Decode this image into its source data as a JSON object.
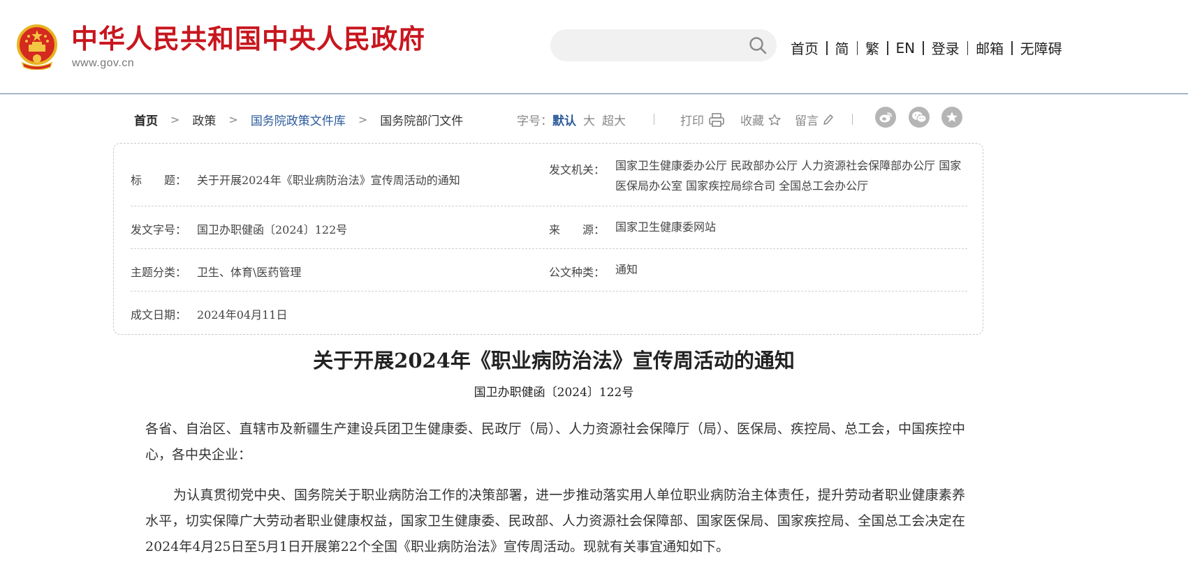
{
  "header": {
    "site_title": "中华人民共和国中央人民政府",
    "site_domain": "www.gov.cn",
    "search_placeholder": "",
    "nav": [
      "首页",
      "简",
      "繁",
      "EN",
      "登录",
      "邮箱",
      "无障碍"
    ]
  },
  "breadcrumb": {
    "items": [
      "首页",
      "政策",
      "国务院政策文件库",
      "国务院部门文件"
    ],
    "separator": ">"
  },
  "toolbar": {
    "font_size_label": "字号：",
    "font_options": [
      "默认",
      "大",
      "超大"
    ],
    "print_label": "打印",
    "favorite_label": "收藏",
    "comment_label": "留言",
    "share_icons": [
      "weibo-icon",
      "wechat-icon",
      "favorite-star-icon"
    ]
  },
  "info": {
    "title_label": "标　　题：",
    "title_value": "关于开展2024年《职业病防治法》宣传周活动的通知",
    "issuer_label": "发文机关：",
    "issuer_value": "国家卫生健康委办公厅  民政部办公厅  人力资源社会保障部办公厅  国家医保局办公室  国家疾控局综合司  全国总工会办公厅",
    "docno_label": "发文字号：",
    "docno_value": "国卫办职健函〔2024〕122号",
    "source_label": "来　　源：",
    "source_value": "国家卫生健康委网站",
    "category_label": "主题分类：",
    "category_value": "卫生、体育\\医药管理",
    "type_label": "公文种类：",
    "type_value": "通知",
    "date_label": "成文日期：",
    "date_value": "2024年04月11日"
  },
  "article": {
    "title": "关于开展2024年《职业病防治法》宣传周活动的通知",
    "doc_number": "国卫办职健函〔2024〕122号",
    "paragraphs": [
      "各省、自治区、直辖市及新疆生产建设兵团卫生健康委、民政厅（局）、人力资源社会保障厅（局）、医保局、疾控局、总工会，中国疾控中心，各中央企业：",
      "为认真贯彻党中央、国务院关于职业病防治工作的决策部署，进一步推动落实用人单位职业病防治主体责任，提升劳动者职业健康素养水平，切实保障广大劳动者职业健康权益，国家卫生健康委、民政部、人力资源社会保障部、国家医保局、国家疾控局、全国总工会决定在2024年4月25日至5月1日开展第22个全国《职业病防治法》宣传周活动。现就有关事宜通知如下。"
    ]
  },
  "colors": {
    "brand_red": "#c8161e",
    "link_blue": "#2b5a9b",
    "header_rule": "#5b7a9e"
  }
}
